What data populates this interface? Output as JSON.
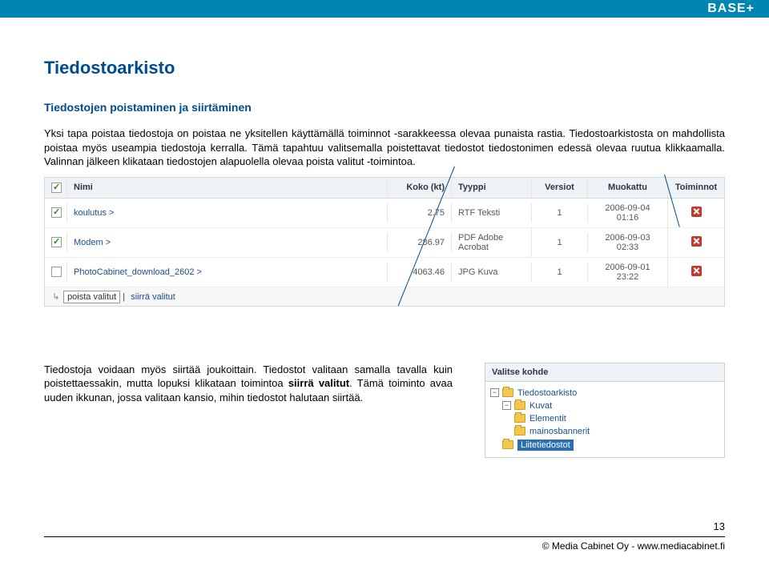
{
  "brand": "BASE+",
  "heading": "Tiedostoarkisto",
  "subheading": "Tiedostojen poistaminen ja siirtäminen",
  "para1": "Yksi tapa poistaa tiedostoja on poistaa ne yksitellen käyttämällä toiminnot -sarakkeessa olevaa punaista rastia. Tiedostoarkistosta on mahdollista poistaa myös useampia tiedostoja kerralla. Tämä tapahtuu valitsemalla poistettavat tiedostot tiedostonimen edessä olevaa ruutua klikkaamalla. Valinnan jälkeen klikataan tiedostojen alapuolella olevaa poista valitut -toimintoa.",
  "table": {
    "headers": {
      "name": "Nimi",
      "size": "Koko (kt)",
      "type": "Tyyppi",
      "versions": "Versiot",
      "modified": "Muokattu",
      "actions": "Toiminnot"
    },
    "rows": [
      {
        "checked": true,
        "name": "koulutus >",
        "size": "2.75",
        "type": "RTF Teksti",
        "versions": "1",
        "modified": "2006-09-04 01:16"
      },
      {
        "checked": true,
        "name": "Modem >",
        "size": "286.97",
        "type": "PDF Adobe Acrobat",
        "versions": "1",
        "modified": "2006-09-03 02:33"
      },
      {
        "checked": false,
        "name": "PhotoCabinet_download_2602 >",
        "size": "4063.46",
        "type": "JPG Kuva",
        "versions": "1",
        "modified": "2006-09-01 23:22"
      }
    ],
    "footer": {
      "arrow": "↳",
      "poista": "poista valitut",
      "siirra": "siirrä valitut"
    }
  },
  "para2_a": "Tiedostoja voidaan myös siirtää joukoittain. Tiedostot valitaan samalla tavalla kuin poistettaessakin, mutta lopuksi klikataan toimintoa ",
  "para2_b": "siirrä valitut",
  "para2_c": ". Tämä toiminto avaa uuden ikkunan, jossa valitaan kansio, mihin tiedostot halutaan siirtää.",
  "tree": {
    "title": "Valitse kohde",
    "items": [
      {
        "indent": 0,
        "toggle": "−",
        "label": "Tiedostoarkisto",
        "selected": false
      },
      {
        "indent": 1,
        "toggle": "−",
        "label": "Kuvat",
        "selected": false
      },
      {
        "indent": 2,
        "toggle": "",
        "label": "Elementit",
        "selected": false
      },
      {
        "indent": 2,
        "toggle": "",
        "label": "mainosbannerit",
        "selected": false
      },
      {
        "indent": 1,
        "toggle": "",
        "label": "Liitetiedostot",
        "selected": true
      }
    ]
  },
  "page_number": "13",
  "footer": "© Media Cabinet Oy - www.mediacabinet.fi"
}
